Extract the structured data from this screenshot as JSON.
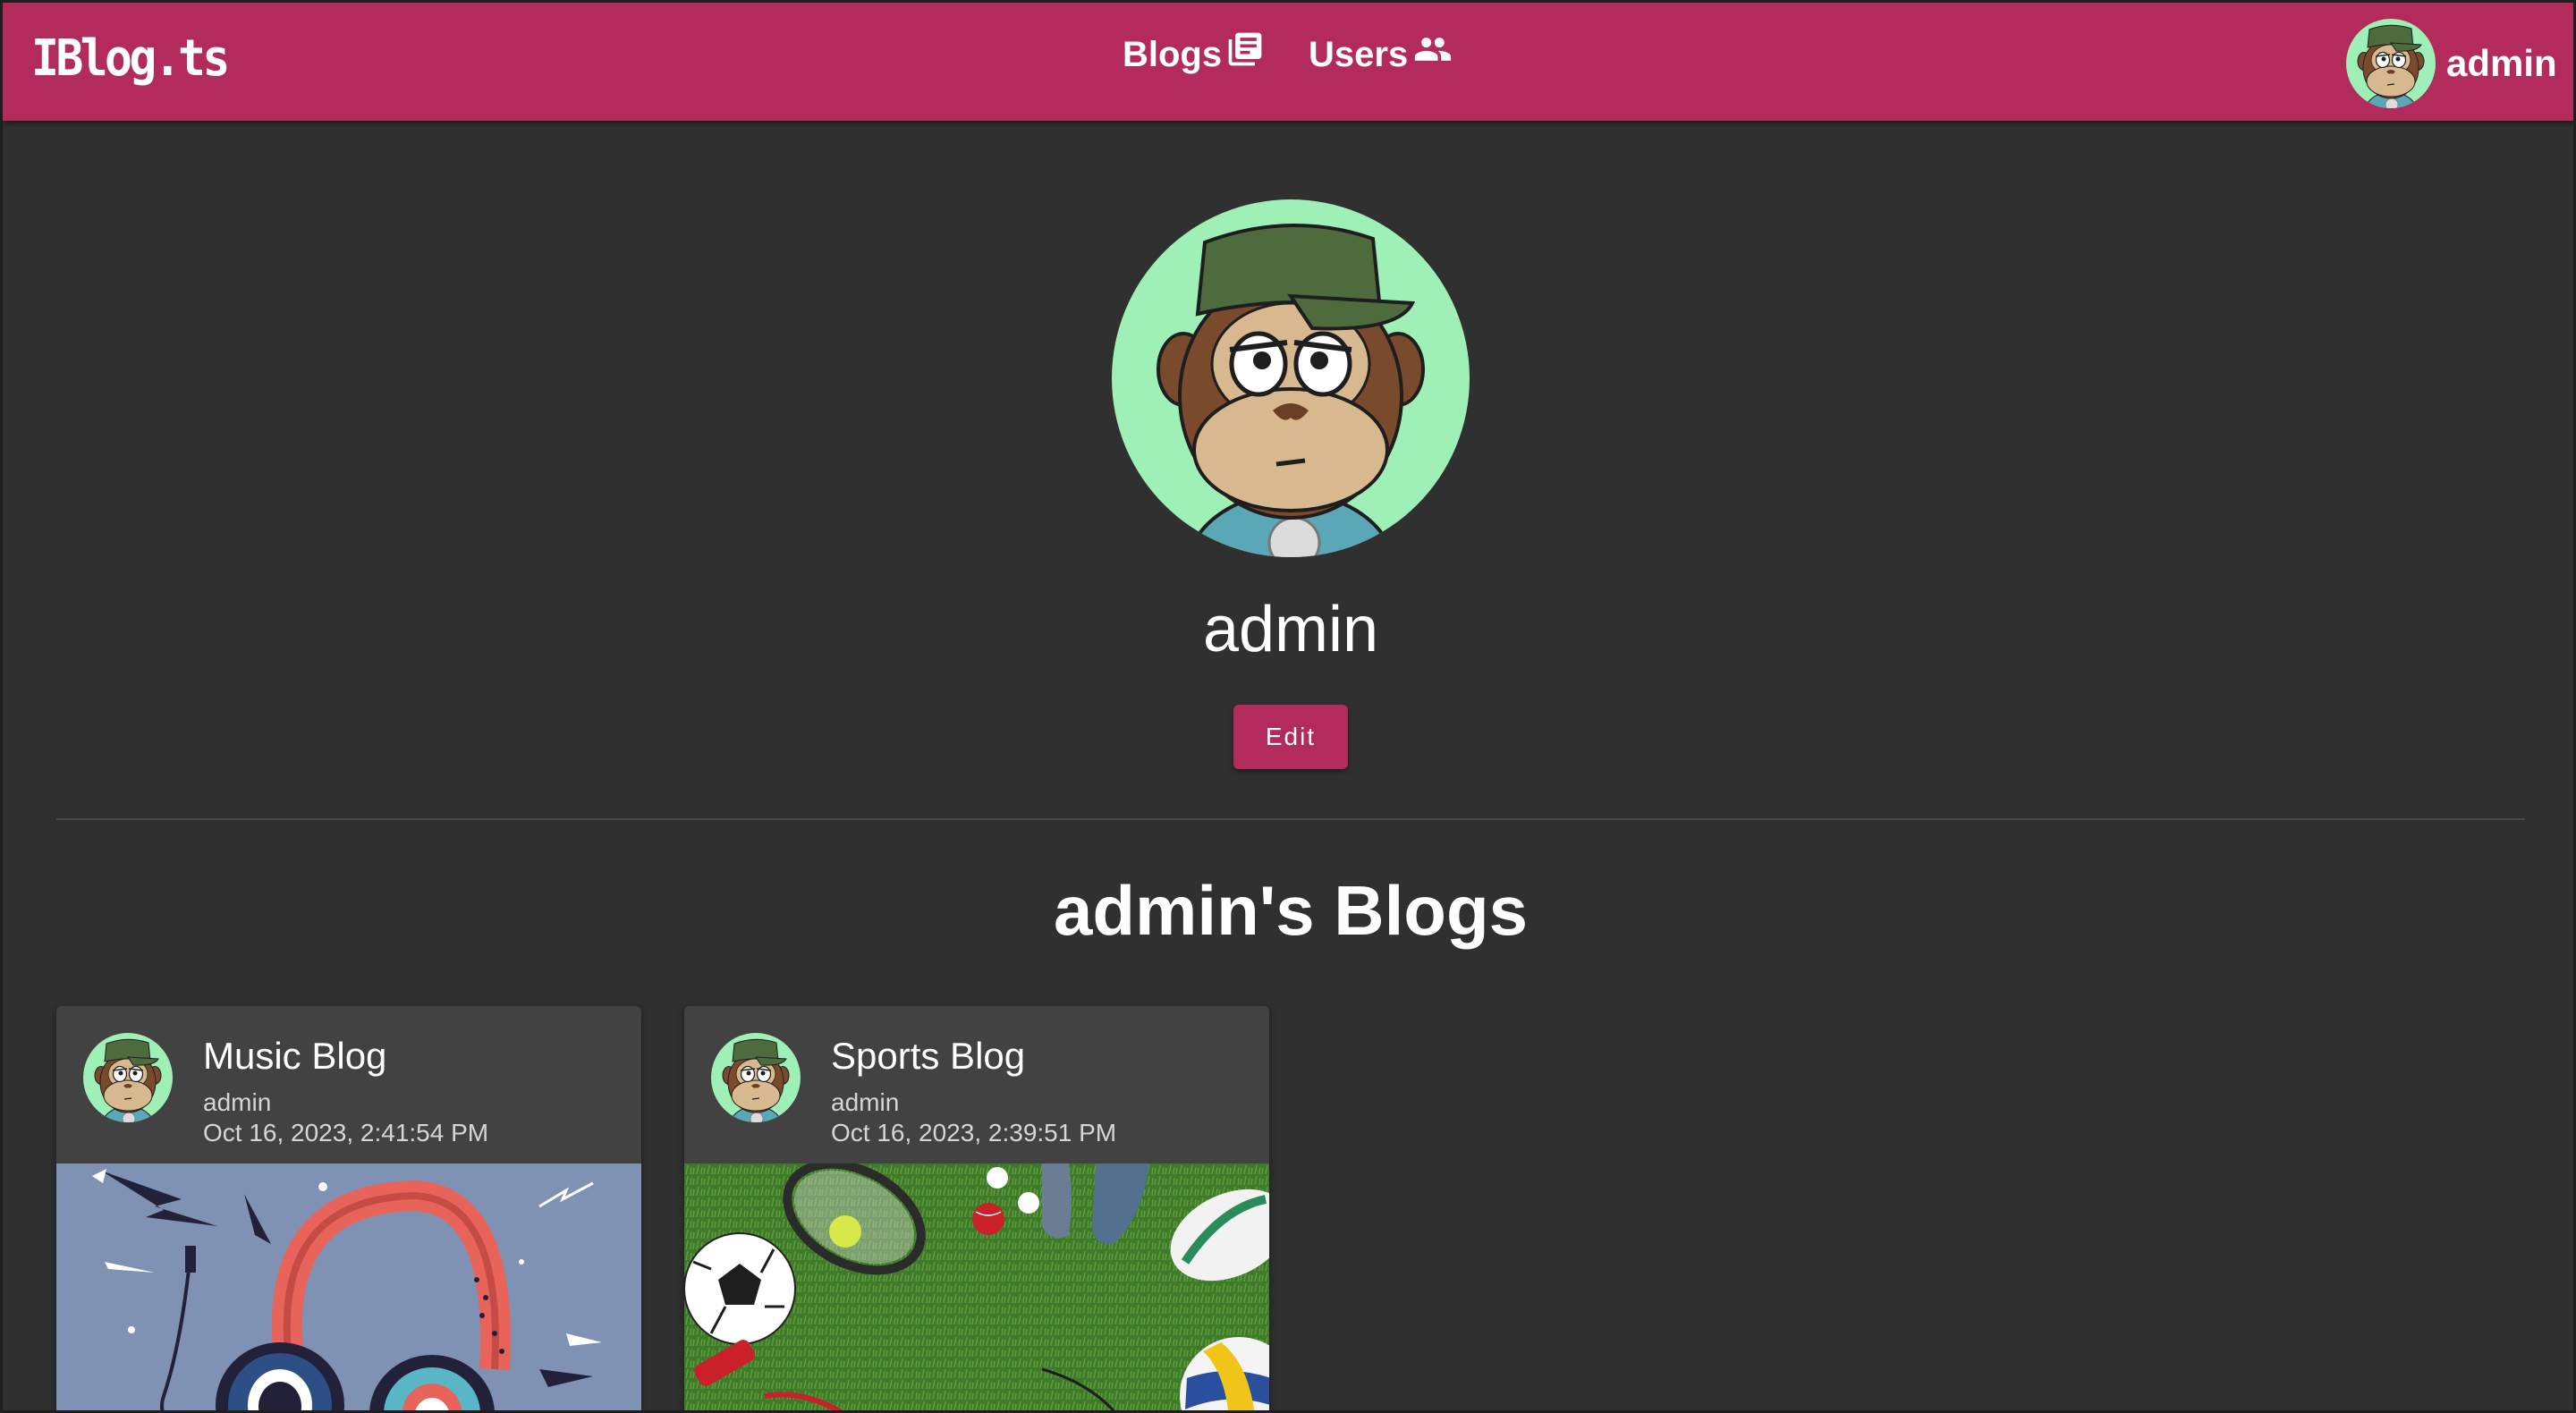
{
  "app": {
    "brand": "IBlog.ts",
    "nav": {
      "blogs_label": "Blogs",
      "users_label": "Users"
    },
    "user_menu": {
      "label": "admin"
    },
    "accent_color": "#b32b5b",
    "background_color": "#303030"
  },
  "profile": {
    "username": "admin",
    "edit_label": "Edit"
  },
  "blogs_section": {
    "title": "admin's Blogs",
    "cards": [
      {
        "title": "Music Blog",
        "author": "admin",
        "date": "Oct 16, 2023, 2:41:54 PM",
        "media": "headphones-illustration"
      },
      {
        "title": "Sports Blog",
        "author": "admin",
        "date": "Oct 16, 2023, 2:39:51 PM",
        "media": "sports-equipment-on-grass"
      }
    ]
  }
}
